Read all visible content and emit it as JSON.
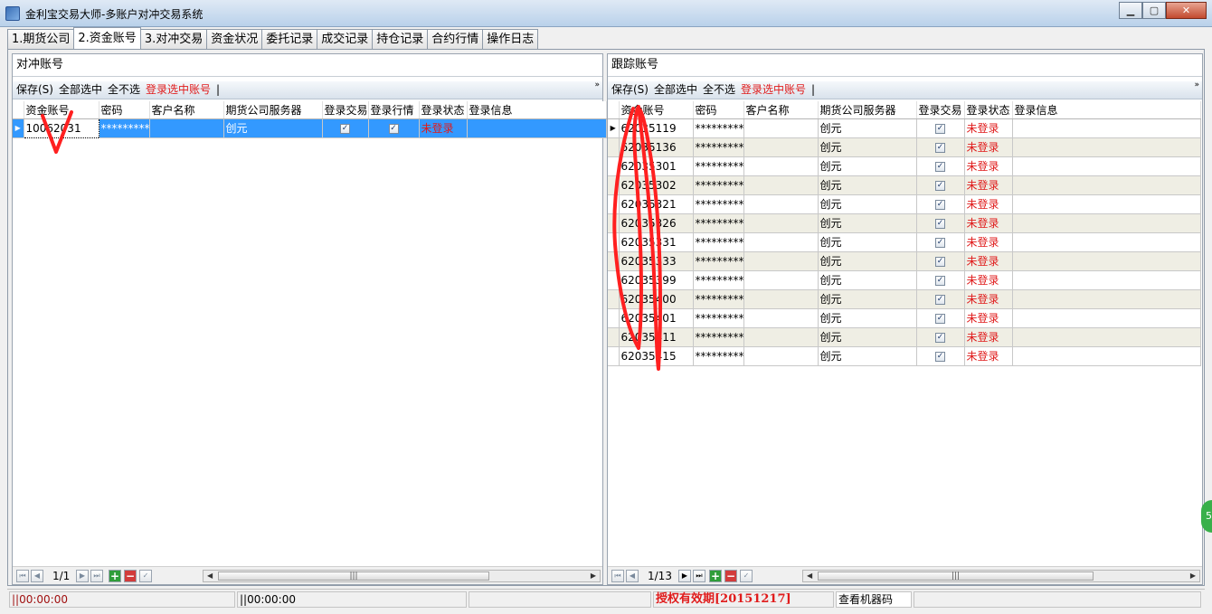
{
  "window": {
    "title": "金利宝交易大师-多账户对冲交易系统",
    "min_label": "▁",
    "max_label": "▢",
    "close_label": "✕"
  },
  "tabs": [
    {
      "label": "1.期货公司"
    },
    {
      "label": "2.资金账号",
      "active": true
    },
    {
      "label": "3.对冲交易"
    },
    {
      "label": "资金状况"
    },
    {
      "label": "委托记录"
    },
    {
      "label": "成交记录"
    },
    {
      "label": "持仓记录"
    },
    {
      "label": "合约行情"
    },
    {
      "label": "操作日志"
    }
  ],
  "toolbar": {
    "save": "保存(S)",
    "select_all": "全部选中",
    "select_none": "全不选",
    "login_selected": "登录选中账号",
    "sep": "|",
    "more": "»"
  },
  "columns": {
    "account": "资金账号",
    "password": "密码",
    "customer": "客户名称",
    "server": "期货公司服务器",
    "login_trade": "登录交易",
    "login_quote": "登录行情",
    "login_status": "登录状态",
    "login_info": "登录信息"
  },
  "left_panel": {
    "title": "对冲账号",
    "rows": [
      {
        "account": "10062031",
        "password": "**********",
        "customer": "",
        "server": "创元",
        "trade": true,
        "quote": true,
        "status": "未登录",
        "info": ""
      }
    ],
    "pager": "1/1"
  },
  "right_panel": {
    "title": "跟踪账号",
    "rows": [
      {
        "account": "62035119",
        "password": "**********",
        "customer": "",
        "server": "创元",
        "trade": true,
        "status": "未登录",
        "info": ""
      },
      {
        "account": "62035136",
        "password": "**********",
        "customer": "",
        "server": "创元",
        "trade": true,
        "status": "未登录",
        "info": ""
      },
      {
        "account": "62035301",
        "password": "**********",
        "customer": "",
        "server": "创元",
        "trade": true,
        "status": "未登录",
        "info": ""
      },
      {
        "account": "62035302",
        "password": "**********",
        "customer": "",
        "server": "创元",
        "trade": true,
        "status": "未登录",
        "info": ""
      },
      {
        "account": "62035321",
        "password": "**********",
        "customer": "",
        "server": "创元",
        "trade": true,
        "status": "未登录",
        "info": ""
      },
      {
        "account": "62035326",
        "password": "**********",
        "customer": "",
        "server": "创元",
        "trade": true,
        "status": "未登录",
        "info": ""
      },
      {
        "account": "62035331",
        "password": "**********",
        "customer": "",
        "server": "创元",
        "trade": true,
        "status": "未登录",
        "info": ""
      },
      {
        "account": "62035333",
        "password": "**********",
        "customer": "",
        "server": "创元",
        "trade": true,
        "status": "未登录",
        "info": ""
      },
      {
        "account": "62035399",
        "password": "**********",
        "customer": "",
        "server": "创元",
        "trade": true,
        "status": "未登录",
        "info": ""
      },
      {
        "account": "62035400",
        "password": "**********",
        "customer": "",
        "server": "创元",
        "trade": true,
        "status": "未登录",
        "info": ""
      },
      {
        "account": "62035401",
        "password": "**********",
        "customer": "",
        "server": "创元",
        "trade": true,
        "status": "未登录",
        "info": ""
      },
      {
        "account": "62035411",
        "password": "**********",
        "customer": "",
        "server": "创元",
        "trade": true,
        "status": "未登录",
        "info": ""
      },
      {
        "account": "62035415",
        "password": "**********",
        "customer": "",
        "server": "创元",
        "trade": true,
        "status": "未登录",
        "info": ""
      }
    ],
    "pager": "1/13"
  },
  "statusbar": {
    "time1": "||00:00:00",
    "time2": "||00:00:00",
    "license": "授权有效期[20151217]",
    "machine_code": "查看机器码"
  },
  "side_badge": "5",
  "colors": {
    "accent_red": "#e01b1b",
    "selection_blue": "#3399ff",
    "alt_row": "#efeee4"
  }
}
